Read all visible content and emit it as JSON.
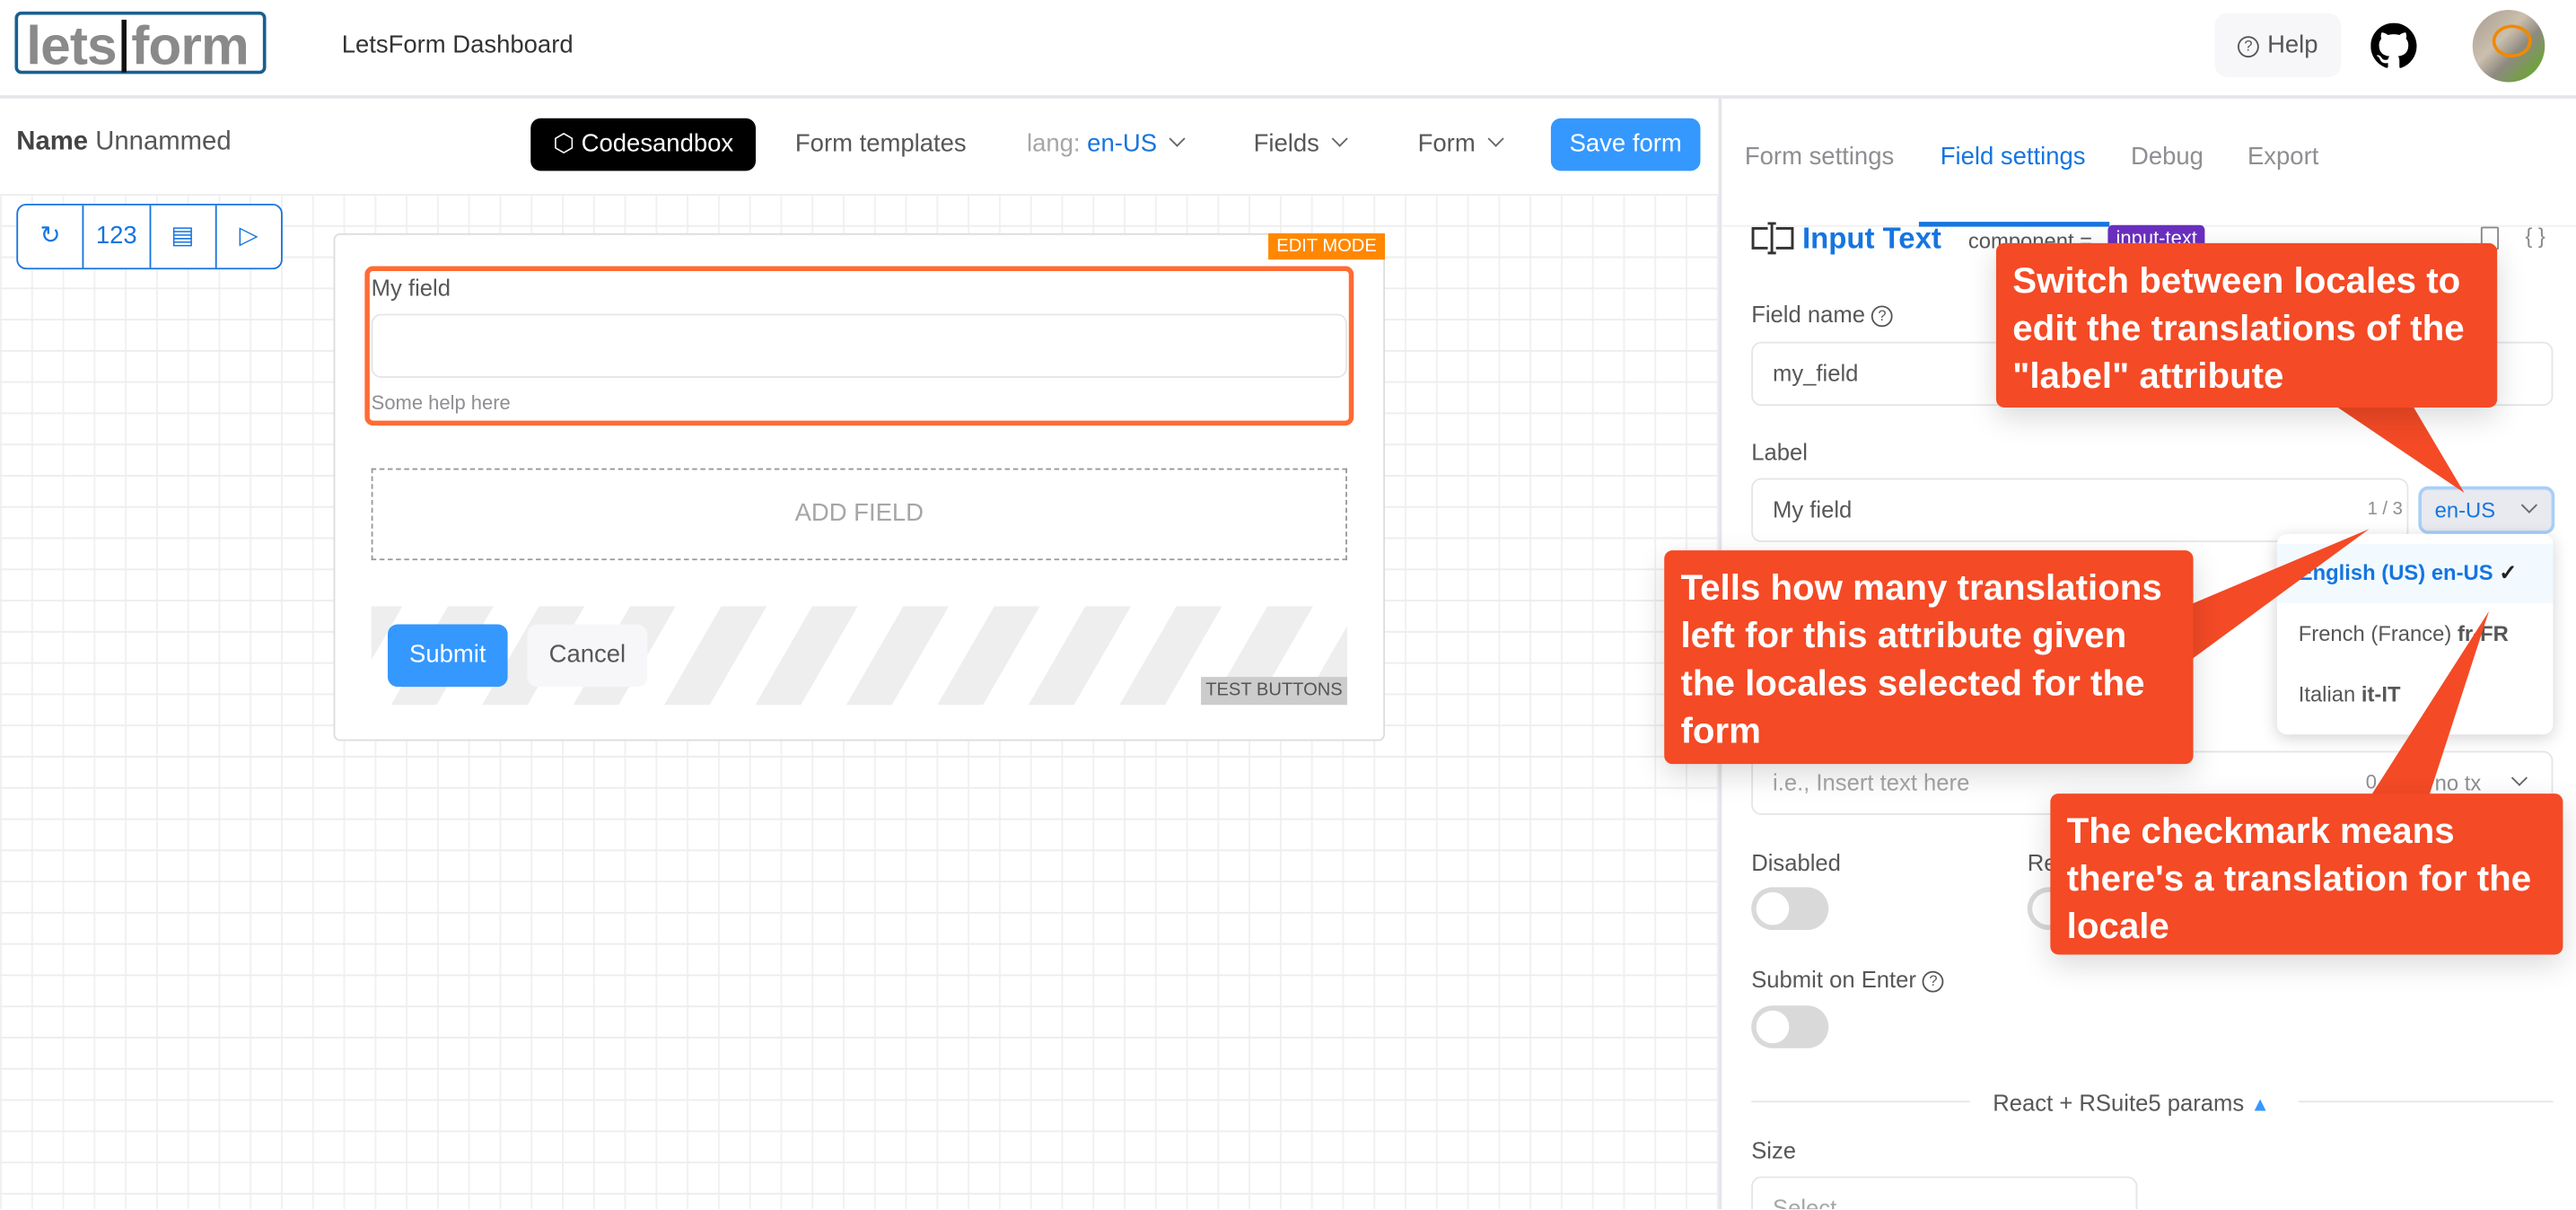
{
  "header": {
    "logo_text": "letsIform",
    "title": "LetsForm Dashboard",
    "help_label": "Help",
    "help_icon": "question-circle-icon",
    "github_icon": "github-icon",
    "avatar": "user-avatar"
  },
  "toolbar": {
    "name_label": "Name",
    "name_value": "Unnammed",
    "codesandbox_label": "Codesandbox",
    "form_templates_label": "Form templates",
    "lang_label": "lang:",
    "lang_value": "en-US",
    "fields_label": "Fields",
    "form_label": "Form",
    "save_label": "Save form",
    "tools": [
      "reload-icon",
      "number-icon",
      "document-icon",
      "play-icon"
    ],
    "tool_glyphs": [
      "↻",
      "123",
      "▤",
      "▷"
    ]
  },
  "form_preview": {
    "edit_mode": "EDIT MODE",
    "field_label": "My field",
    "field_help": "Some help here",
    "add_field": "ADD FIELD",
    "submit": "Submit",
    "cancel": "Cancel",
    "test_buttons": "TEST BUTTONS"
  },
  "panel": {
    "tabs": [
      {
        "label": "Form settings",
        "active": false
      },
      {
        "label": "Field settings",
        "active": true
      },
      {
        "label": "Debug",
        "active": false
      },
      {
        "label": "Export",
        "active": false
      }
    ],
    "component_title": "Input Text",
    "component_eq": "component =",
    "component_badge": "input-text",
    "field_name_label": "Field name",
    "field_name_value": "my_field",
    "label_label": "Label",
    "label_value": "My field",
    "label_count": "1 / 3",
    "label_locale": "en-US",
    "locale_options": [
      {
        "name": "English (US)",
        "code": "en-US",
        "selected": true,
        "translated": true
      },
      {
        "name": "French (France)",
        "code": "fr-FR",
        "selected": false,
        "translated": false
      },
      {
        "name": "Italian",
        "code": "it-IT",
        "selected": false,
        "translated": false
      }
    ],
    "checkmark": "✓",
    "placeholder_placeholder": "i.e., Insert text here",
    "placeholder_count": "0",
    "placeholder_locale": "no tx",
    "disabled_label": "Disabled",
    "readonly_label": "Re",
    "submit_on_enter_label": "Submit on Enter",
    "section_label": "React + RSuite5 params",
    "size_label": "Size",
    "size_placeholder": "Select"
  },
  "callouts": {
    "switch_locales": "Switch between locales to edit the translations of the \"label\" attribute",
    "translations_left": "Tells how many translations left for this attribute given the locales selected for the form",
    "checkmark_meaning": "The checkmark means there's a translation for the locale"
  },
  "colors": {
    "accent": "#1675e0",
    "primary_button": "#3498ff",
    "edit_mode": "#ff8800",
    "field_highlight": "#ff6b35",
    "callout": "#f44a26",
    "badge": "#6b2fc0"
  }
}
